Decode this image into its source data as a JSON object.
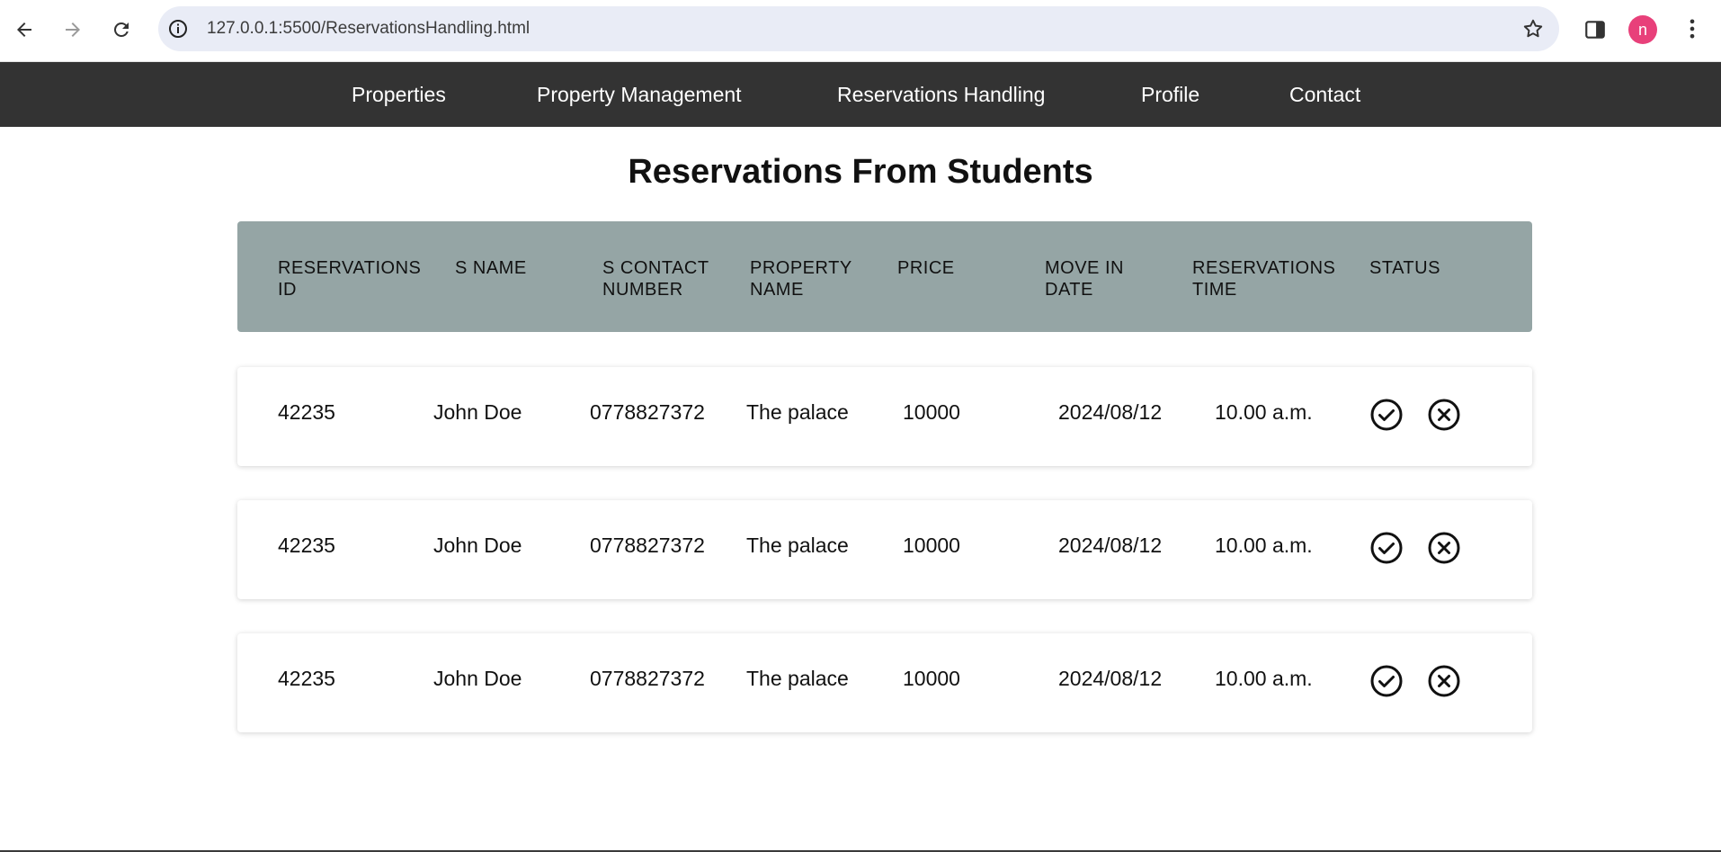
{
  "browser": {
    "url": "127.0.0.1:5500/ReservationsHandling.html",
    "profile_initial": "n",
    "icons": [
      "back-icon",
      "forward-icon",
      "reload-icon",
      "info-icon",
      "star-icon",
      "side-panel-icon",
      "more-icon"
    ]
  },
  "nav": {
    "items": [
      "Properties",
      "Property Management",
      "Reservations Handling",
      "Profile",
      "Contact"
    ]
  },
  "page_title": "Reservations From Students",
  "table": {
    "headers": [
      [
        "RESERVATIONS",
        "ID"
      ],
      [
        "S NAME",
        ""
      ],
      [
        "S CONTACT",
        "NUMBER"
      ],
      [
        "PROPERTY",
        "NAME"
      ],
      [
        "PRICE",
        ""
      ],
      [
        "MOVE IN",
        "DATE"
      ],
      [
        "RESERVATIONS",
        "TIME"
      ],
      [
        "STATUS",
        ""
      ]
    ],
    "rows": [
      {
        "id": "42235",
        "name": "John Doe",
        "contact": "0778827372",
        "property": "The palace",
        "price": "10000",
        "move_in": "2024/08/12",
        "time": "10.00 a.m."
      },
      {
        "id": "42235",
        "name": "John Doe",
        "contact": "0778827372",
        "property": "The palace",
        "price": "10000",
        "move_in": "2024/08/12",
        "time": "10.00 a.m."
      },
      {
        "id": "42235",
        "name": "John Doe",
        "contact": "0778827372",
        "property": "The palace",
        "price": "10000",
        "move_in": "2024/08/12",
        "time": "10.00 a.m."
      }
    ],
    "status_icons": [
      "accept-icon",
      "reject-icon"
    ]
  },
  "colors": {
    "nav_bg": "#333333",
    "header_bg": "#95a5a5",
    "avatar_bg": "#e8407a"
  }
}
